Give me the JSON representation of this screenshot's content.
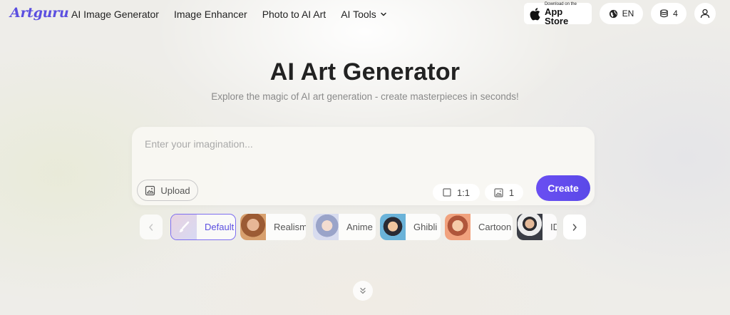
{
  "nav": {
    "logo": "Artguru",
    "links": [
      {
        "label": "AI Image Generator"
      },
      {
        "label": "Image Enhancer"
      },
      {
        "label": "Photo to AI Art"
      },
      {
        "label": "AI Tools"
      }
    ],
    "app_store": {
      "small": "Download on the",
      "big": "App Store",
      "icon": "apple-icon"
    },
    "language": {
      "label": "EN",
      "icon": "globe-icon"
    },
    "credits": {
      "count": "4",
      "icon": "coins-stack-icon"
    },
    "account": {
      "icon": "user-icon"
    }
  },
  "hero": {
    "title": "AI Art Generator",
    "subtitle": "Explore the magic of AI art generation - create masterpieces in seconds!"
  },
  "prompt": {
    "placeholder": "Enter your imagination...",
    "value": "",
    "upload_label": "Upload",
    "aspect_ratio": "1:1",
    "image_count": "1",
    "create_label": "Create"
  },
  "styles": {
    "items": [
      {
        "label": "Default",
        "selected": true
      },
      {
        "label": "Realism",
        "selected": false
      },
      {
        "label": "Anime",
        "selected": false
      },
      {
        "label": "Ghibli",
        "selected": false
      },
      {
        "label": "Cartoon",
        "selected": false
      },
      {
        "label": "ID",
        "selected": false
      }
    ]
  },
  "colors": {
    "brand": "#5b4fe0",
    "create_button": "#6a4ff2",
    "selected_border": "#7d6ef0"
  }
}
